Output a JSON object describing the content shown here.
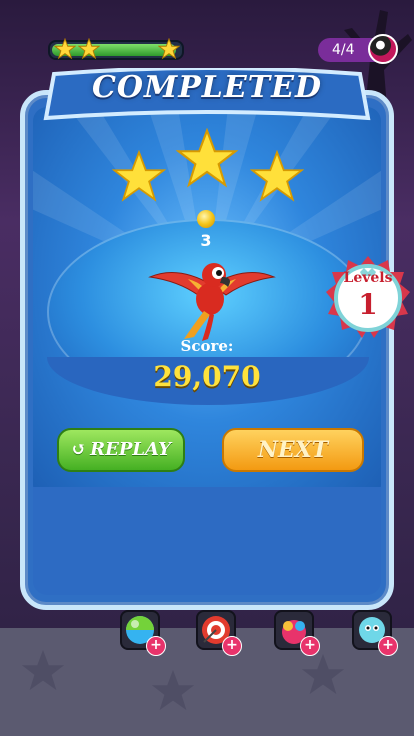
{
  "hud": {
    "moves_text": "4/4",
    "progress_fraction": 0.97,
    "progress_stars_earned": 3
  },
  "dialog": {
    "title": "COMPLETED",
    "stars_earned": 3,
    "coins": "3",
    "score_label": "Score:",
    "score_value": "29,070",
    "level_label": "Levels",
    "level_number": "1",
    "replay_label": "REPLAY",
    "next_label": "NEXT"
  },
  "boosters": [
    {
      "icon": "rainbow-ball-icon",
      "plus": "+"
    },
    {
      "icon": "target-icon",
      "plus": "+"
    },
    {
      "icon": "bomb-ball-icon",
      "plus": "+"
    },
    {
      "icon": "bubble-creature-icon",
      "plus": "+"
    }
  ],
  "colors": {
    "card_blue": "#2f6fc4",
    "score_yellow": "#ffe23d",
    "replay_green": "#45b023",
    "next_orange": "#f39a12",
    "level_red": "#c71f2e"
  }
}
